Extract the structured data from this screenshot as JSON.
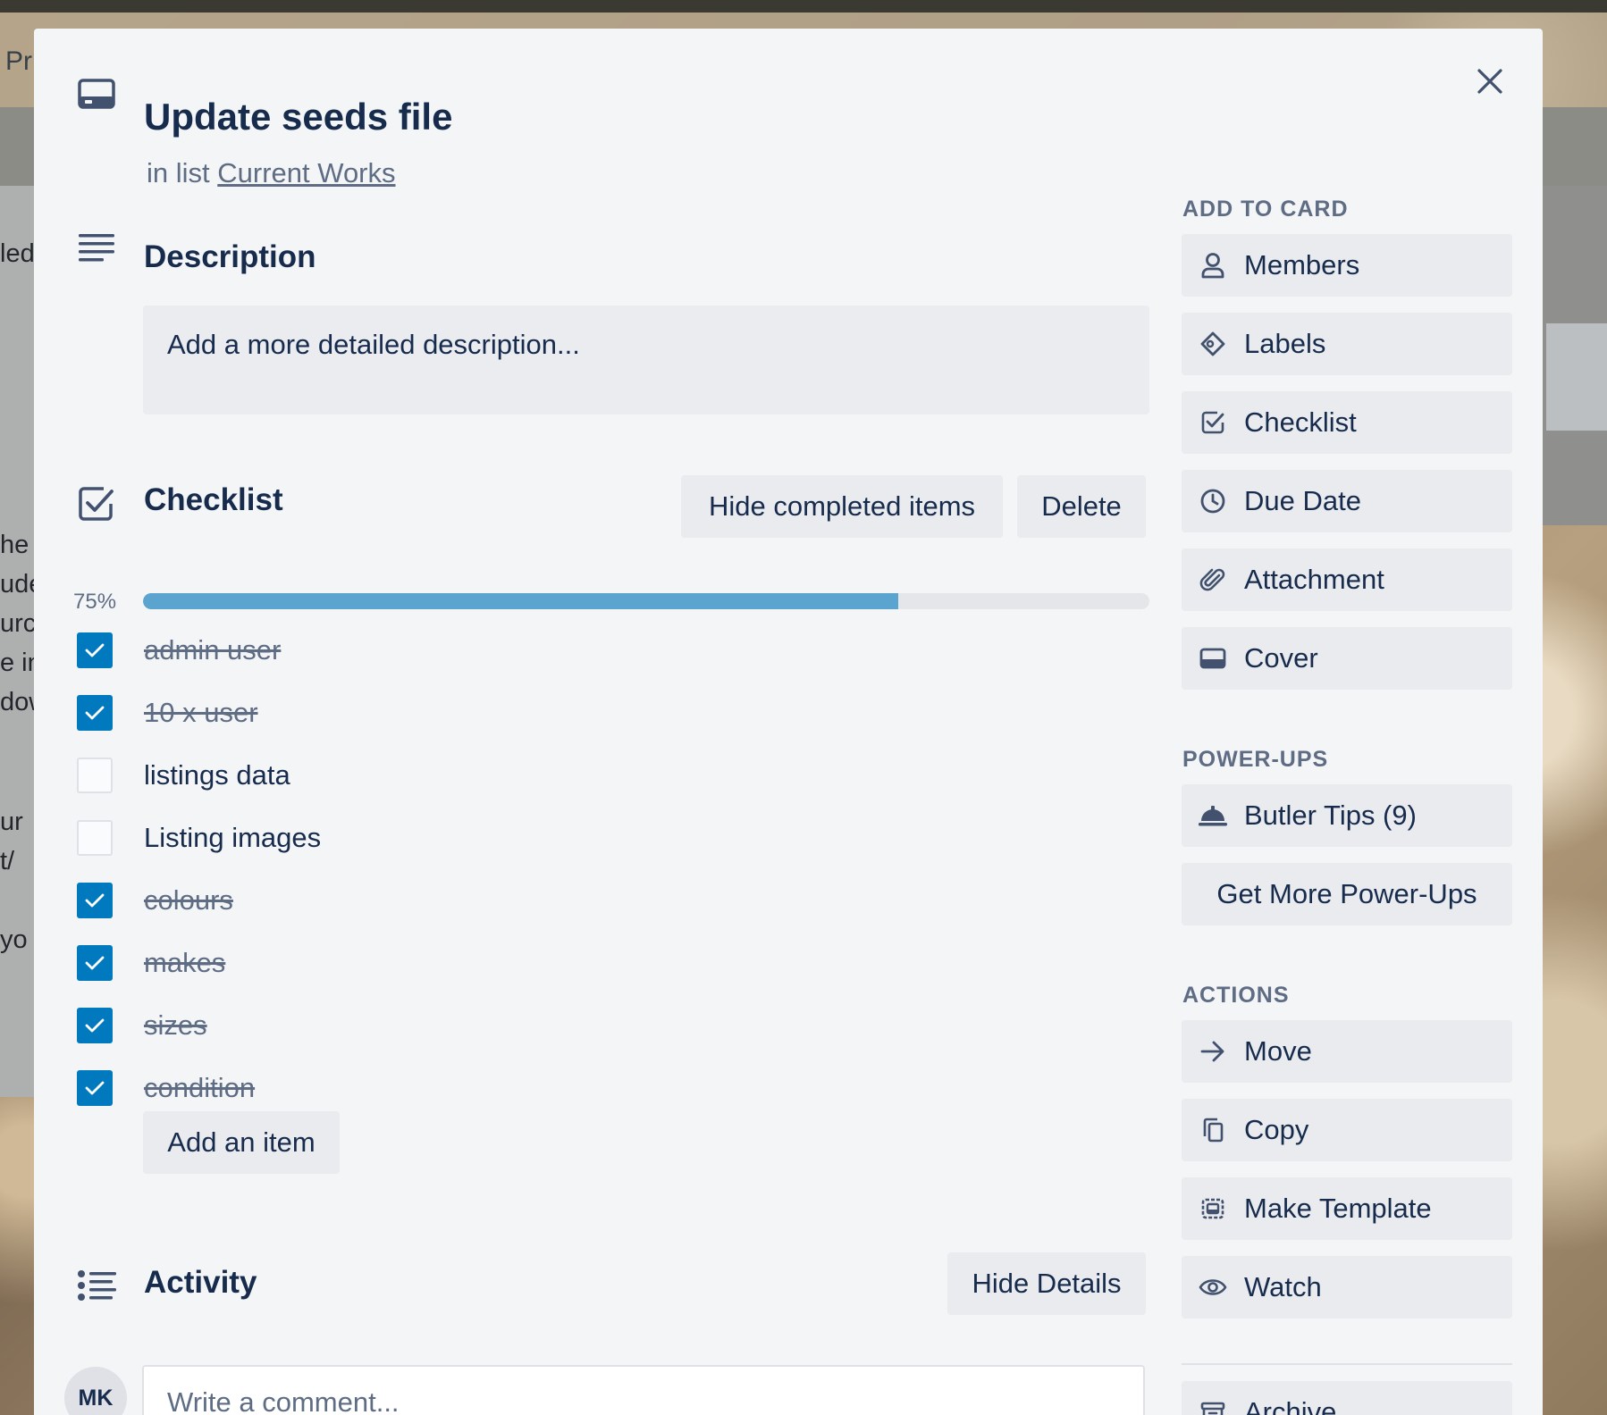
{
  "background": {
    "header_fragment": "Pr",
    "list_fragments": [
      "led",
      "he",
      "ude",
      "urc",
      "e in",
      "dow",
      "ur",
      "t/",
      "yo"
    ]
  },
  "card": {
    "title": "Update seeds file",
    "list_prefix": "in list",
    "list_name": "Current Works"
  },
  "description": {
    "heading": "Description",
    "placeholder": "Add a more detailed description..."
  },
  "checklist": {
    "heading": "Checklist",
    "hide_completed_label": "Hide completed items",
    "delete_label": "Delete",
    "progress_label": "75%",
    "progress_fraction": 0.75,
    "items": [
      {
        "text": "admin user",
        "checked": true
      },
      {
        "text": "10 x user",
        "checked": true
      },
      {
        "text": "listings data",
        "checked": false
      },
      {
        "text": "Listing images",
        "checked": false
      },
      {
        "text": "colours",
        "checked": true
      },
      {
        "text": "makes",
        "checked": true
      },
      {
        "text": "sizes",
        "checked": true
      },
      {
        "text": "condition",
        "checked": true
      }
    ],
    "add_item_label": "Add an item"
  },
  "activity": {
    "heading": "Activity",
    "hide_details_label": "Hide Details",
    "avatar_initials": "MK",
    "comment_placeholder": "Write a comment..."
  },
  "sidebar": {
    "add_to_card_heading": "ADD TO CARD",
    "add_to_card": [
      {
        "label": "Members",
        "icon": "person-icon"
      },
      {
        "label": "Labels",
        "icon": "tag-icon"
      },
      {
        "label": "Checklist",
        "icon": "checkbox-icon"
      },
      {
        "label": "Due Date",
        "icon": "clock-icon"
      },
      {
        "label": "Attachment",
        "icon": "paperclip-icon"
      },
      {
        "label": "Cover",
        "icon": "card-cover-icon"
      }
    ],
    "powerups_heading": "POWER-UPS",
    "butler_label": "Butler Tips (9)",
    "get_more_label": "Get More Power-Ups",
    "actions_heading": "ACTIONS",
    "actions": [
      {
        "label": "Move",
        "icon": "arrow-right-icon"
      },
      {
        "label": "Copy",
        "icon": "copy-icon"
      },
      {
        "label": "Make Template",
        "icon": "template-icon"
      },
      {
        "label": "Watch",
        "icon": "eye-icon"
      },
      {
        "label": "Archive",
        "icon": "archive-icon"
      }
    ]
  },
  "colors": {
    "accent": "#0079bf",
    "progress": "#5ba4cf",
    "text": "#172b4d",
    "muted": "#5e6c84"
  }
}
